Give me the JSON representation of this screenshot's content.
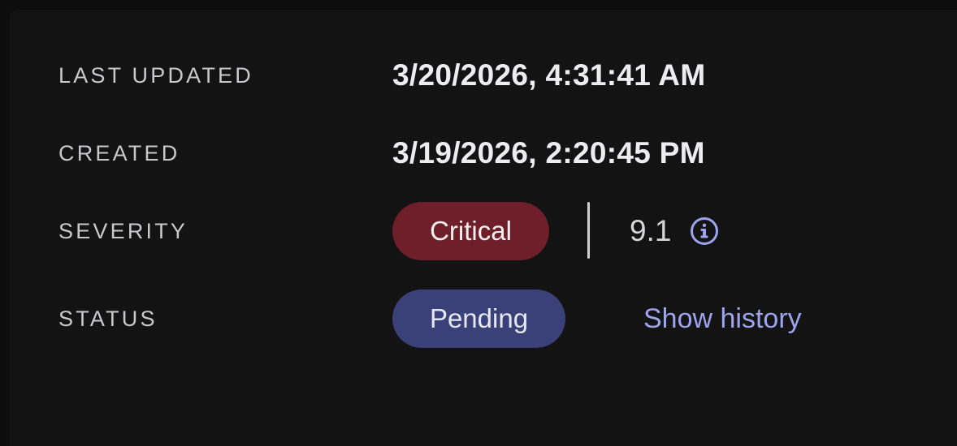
{
  "details": {
    "last_updated": {
      "label": "LAST UPDATED",
      "value": "3/20/2026, 4:31:41 AM"
    },
    "created": {
      "label": "CREATED",
      "value": "3/19/2026, 2:20:45 PM"
    },
    "severity": {
      "label": "SEVERITY",
      "badge": "Critical",
      "badge_color": "#6e1f29",
      "score": "9.1",
      "info_icon": "info-circle-icon",
      "info_icon_color": "#9ea3ee"
    },
    "status": {
      "label": "STATUS",
      "badge": "Pending",
      "badge_color": "#3a4178",
      "history_link": "Show history",
      "link_color": "#9ea3ee"
    }
  }
}
